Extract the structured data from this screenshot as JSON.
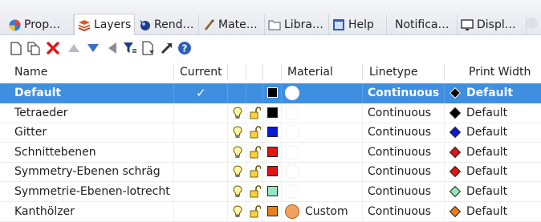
{
  "tabs": [
    {
      "label": "Prop…",
      "icon": "properties-icon"
    },
    {
      "label": "Layers",
      "icon": "layers-icon",
      "active": true
    },
    {
      "label": "Rend…",
      "icon": "render-icon"
    },
    {
      "label": "Mate…",
      "icon": "materials-icon"
    },
    {
      "label": "Libra…",
      "icon": "libraries-folder-icon"
    },
    {
      "label": "Help",
      "icon": "help-icon"
    },
    {
      "label": "Notifica…",
      "icon": ""
    },
    {
      "label": "Displ…",
      "icon": "display-icon"
    }
  ],
  "toolbar": [
    "new-layer-icon",
    "new-sublayer-icon",
    "delete-icon",
    "move-up-icon",
    "move-down-icon",
    "move-left-icon",
    "filter-icon",
    "layer-tools-icon",
    "layer-states-icon",
    "help-icon"
  ],
  "columns": {
    "name": "Name",
    "current": "Current",
    "material": "Material",
    "linetype": "Linetype",
    "print_width": "Print Width"
  },
  "layers": [
    {
      "name": "Default",
      "current": "✓",
      "color": "#000000",
      "material_color": "#ffffff",
      "material_name": "",
      "linetype": "Continuous",
      "print_color": "#000000",
      "print_width": "Default",
      "selected": true
    },
    {
      "name": "Tetraeder",
      "current": "",
      "color": "#000000",
      "material_color": "#ffffff",
      "material_name": "",
      "linetype": "Continuous",
      "print_color": "#000000",
      "print_width": "Default"
    },
    {
      "name": "Gitter",
      "current": "",
      "color": "#0a18d8",
      "material_color": "#ffffff",
      "material_name": "",
      "linetype": "Continuous",
      "print_color": "#0a18d8",
      "print_width": "Default"
    },
    {
      "name": "Schnittebenen",
      "current": "",
      "color": "#e01414",
      "material_color": "#ffffff",
      "material_name": "",
      "linetype": "Continuous",
      "print_color": "#e01414",
      "print_width": "Default"
    },
    {
      "name": "Symmetry-Ebenen schräg",
      "current": "",
      "color": "#e01414",
      "material_color": "#ffffff",
      "material_name": "",
      "linetype": "Continuous",
      "print_color": "#e01414",
      "print_width": "Default"
    },
    {
      "name": "Symmetrie-Ebenen-lotrecht",
      "current": "",
      "color": "#90e8c0",
      "material_color": "#ffffff",
      "material_name": "",
      "linetype": "Continuous",
      "print_color": "#90e8c0",
      "print_width": "Default"
    },
    {
      "name": "Kanthölzer",
      "current": "",
      "color": "#e8801e",
      "material_color": "#f0a060",
      "material_name": "Custom",
      "linetype": "Continuous",
      "print_color": "#e8801e",
      "print_width": "Default"
    }
  ]
}
